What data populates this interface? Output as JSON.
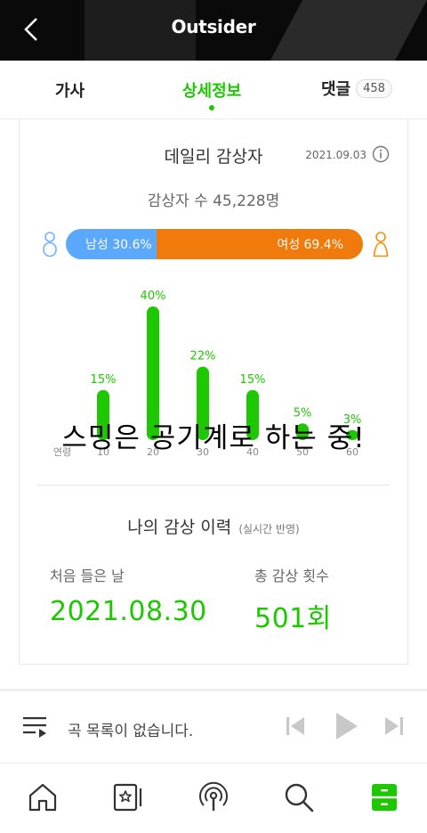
{
  "header": {
    "title": "Outsider",
    "back_icon": "chevron-left-icon"
  },
  "tabs": [
    {
      "label": "가사",
      "active": false
    },
    {
      "label": "상세정보",
      "active": true
    },
    {
      "label": "댓글",
      "count": "458",
      "active": false
    }
  ],
  "daily_listeners": {
    "title": "데일리 감상자",
    "date": "2021.09.03",
    "count_text": "감상자 수 45,228명",
    "male_label": "남성 30.6%",
    "female_label": "여성 69.4%",
    "male_share": 30.6,
    "female_share": 69.4
  },
  "chart_data": {
    "type": "bar",
    "categories": [
      "10",
      "20",
      "30",
      "40",
      "50",
      "60"
    ],
    "values": [
      15,
      40,
      22,
      15,
      5,
      3
    ],
    "value_labels": [
      "15%",
      "40%",
      "22%",
      "15%",
      "5%",
      "3%"
    ],
    "first_category_prefix": "연령",
    "ylim": [
      0,
      40
    ],
    "grid": false
  },
  "overlay_text": "스밍은 공기계로 하는 중!",
  "history": {
    "title": "나의 감상 이력",
    "subtitle": "(실시간 반영)",
    "first_label": "처음 들은 날",
    "first_value": "2021.08.30",
    "total_label": "총 감상 횟수",
    "total_value": "501회"
  },
  "player": {
    "message": "곡 목록이 없습니다."
  },
  "nav": [
    {
      "icon": "home-icon"
    },
    {
      "icon": "music-card-icon"
    },
    {
      "icon": "podcast-icon"
    },
    {
      "icon": "search-icon"
    },
    {
      "icon": "library-icon",
      "active": true
    }
  ],
  "colors": {
    "accent": "#1ec800",
    "male": "#5aa9ff",
    "female": "#f07a0c"
  }
}
